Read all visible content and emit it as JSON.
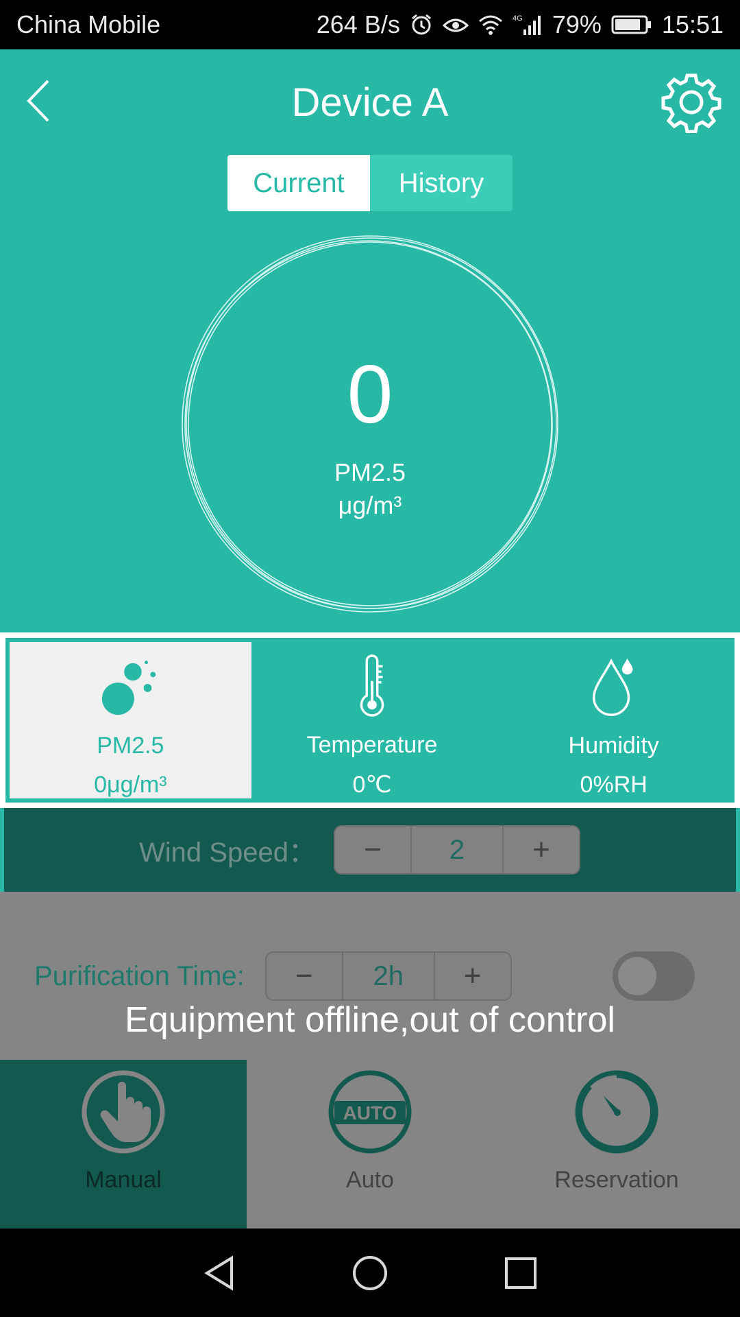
{
  "status_bar": {
    "carrier": "China Mobile",
    "net_speed": "264 B/s",
    "network_type": "4G",
    "battery": "79%",
    "time": "15:51"
  },
  "header": {
    "title": "Device A"
  },
  "tabs": {
    "current": "Current",
    "history": "History",
    "active": "Current"
  },
  "dial": {
    "value": "0",
    "label": "PM2.5",
    "unit": "μg/m³"
  },
  "sensors": [
    {
      "name": "PM2.5",
      "value": "0μg/m³",
      "icon": "particles-icon",
      "active": true
    },
    {
      "name": "Temperature",
      "value": "0℃",
      "icon": "thermometer-icon",
      "active": false
    },
    {
      "name": "Humidity",
      "value": "0%RH",
      "icon": "water-drop-icon",
      "active": false
    }
  ],
  "wind_speed": {
    "label": "Wind Speed：",
    "minus": "−",
    "value": "2",
    "plus": "+"
  },
  "purification_time": {
    "label": "Purification Time:",
    "minus": "−",
    "value": "2h",
    "plus": "+",
    "enabled": false
  },
  "offline_message": "Equipment offline,out of control",
  "modes": [
    {
      "name": "Manual",
      "icon": "hand-icon",
      "active": true
    },
    {
      "name": "Auto",
      "icon": "auto-icon",
      "badge": "AUTO",
      "active": false
    },
    {
      "name": "Reservation",
      "icon": "timer-icon",
      "active": false
    }
  ],
  "colors": {
    "primary": "#27b8a6",
    "dark": "#13594f",
    "disabled": "#858585"
  }
}
